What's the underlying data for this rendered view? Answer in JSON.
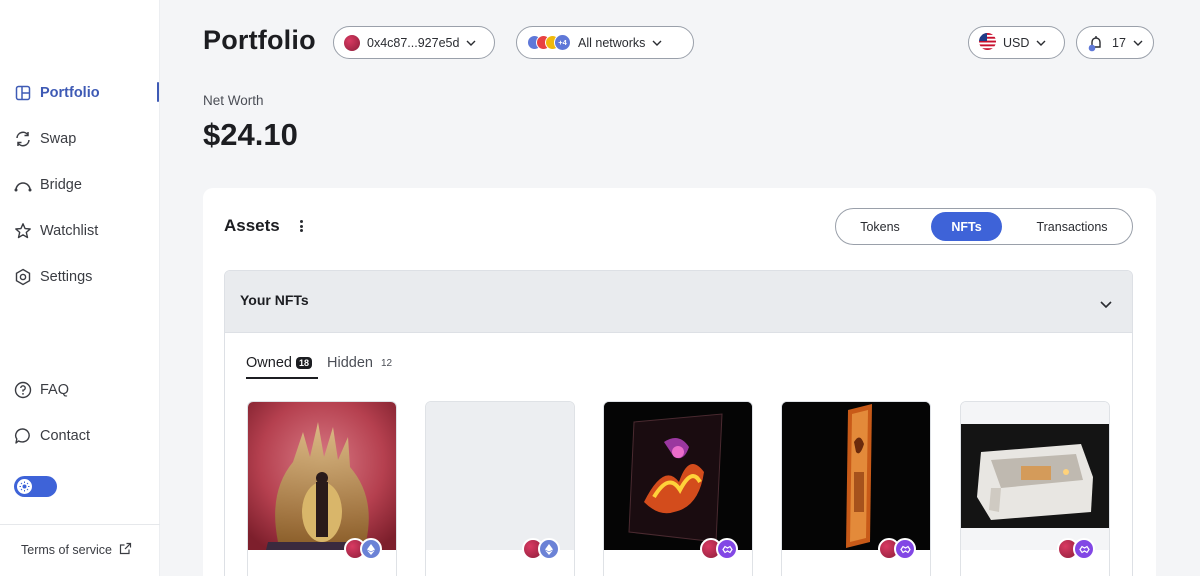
{
  "sidebar": {
    "items": [
      {
        "label": "Portfolio",
        "icon": "portfolio-icon",
        "active": true
      },
      {
        "label": "Swap",
        "icon": "swap-icon"
      },
      {
        "label": "Bridge",
        "icon": "bridge-icon"
      },
      {
        "label": "Watchlist",
        "icon": "star-icon"
      },
      {
        "label": "Settings",
        "icon": "settings-icon"
      },
      {
        "label": "FAQ",
        "icon": "question-icon"
      },
      {
        "label": "Contact",
        "icon": "chat-icon"
      }
    ],
    "theme_toggle": {
      "icon": "sun-icon"
    },
    "terms_label": "Terms of service"
  },
  "header": {
    "title": "Portfolio",
    "account": "0x4c87...927e5d",
    "networks_more": "+4",
    "networks_label": "All networks",
    "currency": "USD",
    "notifications_count": "17"
  },
  "net_worth": {
    "label": "Net Worth",
    "value": "$24.10"
  },
  "assets": {
    "title": "Assets",
    "tabs": [
      {
        "label": "Tokens"
      },
      {
        "label": "NFTs",
        "active": true
      },
      {
        "label": "Transactions"
      }
    ]
  },
  "nfts": {
    "section_title": "Your NFTs",
    "owned_label": "Owned",
    "owned_count": "18",
    "hidden_label": "Hidden",
    "hidden_count": "12",
    "cards": [
      {
        "chain": "ethereum"
      },
      {
        "chain": "ethereum"
      },
      {
        "chain": "polygon"
      },
      {
        "chain": "polygon"
      },
      {
        "chain": "polygon"
      }
    ]
  },
  "colors": {
    "accent": "#3e63d8",
    "nav_active": "#3e5ab5",
    "ethereum": "#6b82d6",
    "polygon": "#8247e5"
  }
}
